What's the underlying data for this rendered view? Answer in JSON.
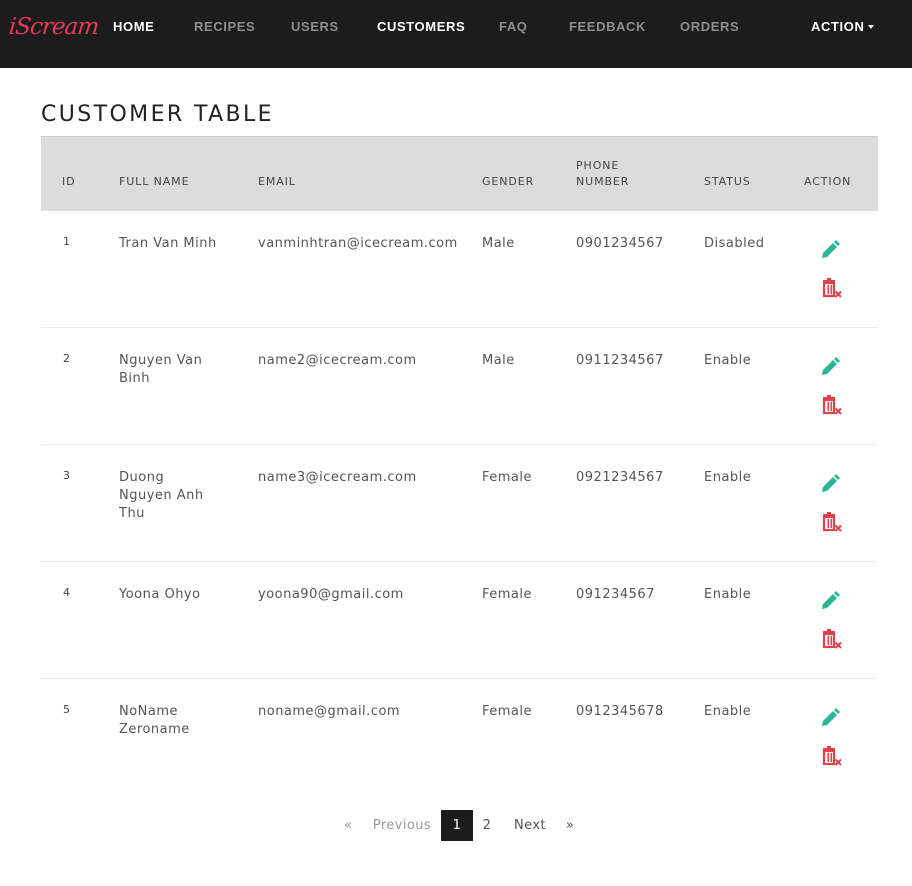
{
  "brand": "iScream",
  "nav": {
    "items": [
      {
        "label": "HOME",
        "active": true
      },
      {
        "label": "RECIPES",
        "active": false
      },
      {
        "label": "USERS",
        "active": false
      },
      {
        "label": "CUSTOMERS",
        "active": true
      },
      {
        "label": "FAQ",
        "active": false
      },
      {
        "label": "FEEDBACK",
        "active": false
      },
      {
        "label": "ORDERS",
        "active": false
      }
    ],
    "action_label": "ACTION"
  },
  "page_title": "CUSTOMER TABLE",
  "table": {
    "headers": {
      "id": "ID",
      "full_name": "FULL NAME",
      "email": "EMAIL",
      "gender": "GENDER",
      "phone_number": "PHONE NUMBER",
      "status": "STATUS",
      "action": "ACTION"
    },
    "rows": [
      {
        "id": "1",
        "full_name": "Tran Van Minh",
        "email": "vanminhtran@icecream.com",
        "gender": "Male",
        "phone": "0901234567",
        "status": "Disabled"
      },
      {
        "id": "2",
        "full_name": "Nguyen Van Binh",
        "email": "name2@icecream.com",
        "gender": "Male",
        "phone": "0911234567",
        "status": "Enable"
      },
      {
        "id": "3",
        "full_name": "Duong Nguyen Anh Thu",
        "email": "name3@icecream.com",
        "gender": "Female",
        "phone": "0921234567",
        "status": "Enable"
      },
      {
        "id": "4",
        "full_name": "Yoona Ohyo",
        "email": "yoona90@gmail.com",
        "gender": "Female",
        "phone": "091234567",
        "status": "Enable"
      },
      {
        "id": "5",
        "full_name": "NoName Zeroname",
        "email": "noname@gmail.com",
        "gender": "Female",
        "phone": "0912345678",
        "status": "Enable"
      }
    ]
  },
  "pagination": {
    "first": "«",
    "previous": "Previous",
    "pages": [
      "1",
      "2"
    ],
    "current_page": "1",
    "next": "Next",
    "last": "»"
  },
  "colors": {
    "navbar_bg": "#1c1c1c",
    "brand": "#e8395b",
    "edit_icon": "#2bb693",
    "delete_icon": "#e0414b",
    "table_header_bg": "#dcdcdc"
  },
  "icons": {
    "edit": "pencil-icon",
    "delete": "trash-x-icon",
    "dropdown": "caret-down-icon"
  }
}
